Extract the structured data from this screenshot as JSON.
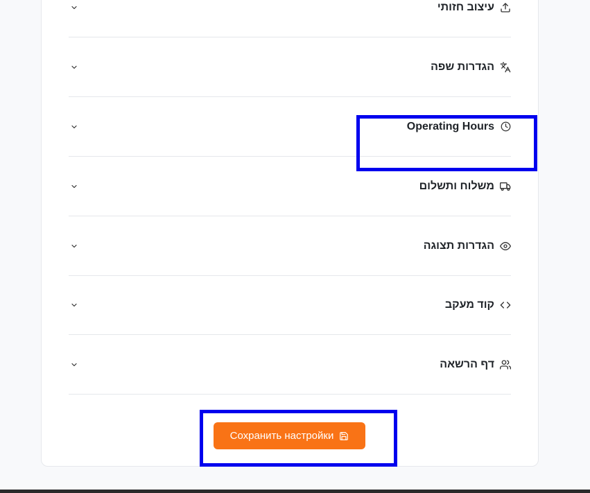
{
  "sections": [
    {
      "label": "עיצוב חזותי",
      "icon": "upload-icon"
    },
    {
      "label": "הגדרות שפה",
      "icon": "translate-icon"
    },
    {
      "label": "Operating Hours",
      "icon": "clock-icon"
    },
    {
      "label": "משלוח ותשלום",
      "icon": "truck-icon"
    },
    {
      "label": "הגדרות תצוגה",
      "icon": "eye-icon"
    },
    {
      "label": "קוד מעקב",
      "icon": "code-icon"
    },
    {
      "label": "דף הרשאה",
      "icon": "users-icon"
    }
  ],
  "save_button": {
    "label": "Сохранить настройки",
    "icon": "save-icon"
  },
  "colors": {
    "accent": "#f97316",
    "highlight": "#0000ee",
    "border": "#e5e7eb",
    "text": "#1f2328"
  }
}
